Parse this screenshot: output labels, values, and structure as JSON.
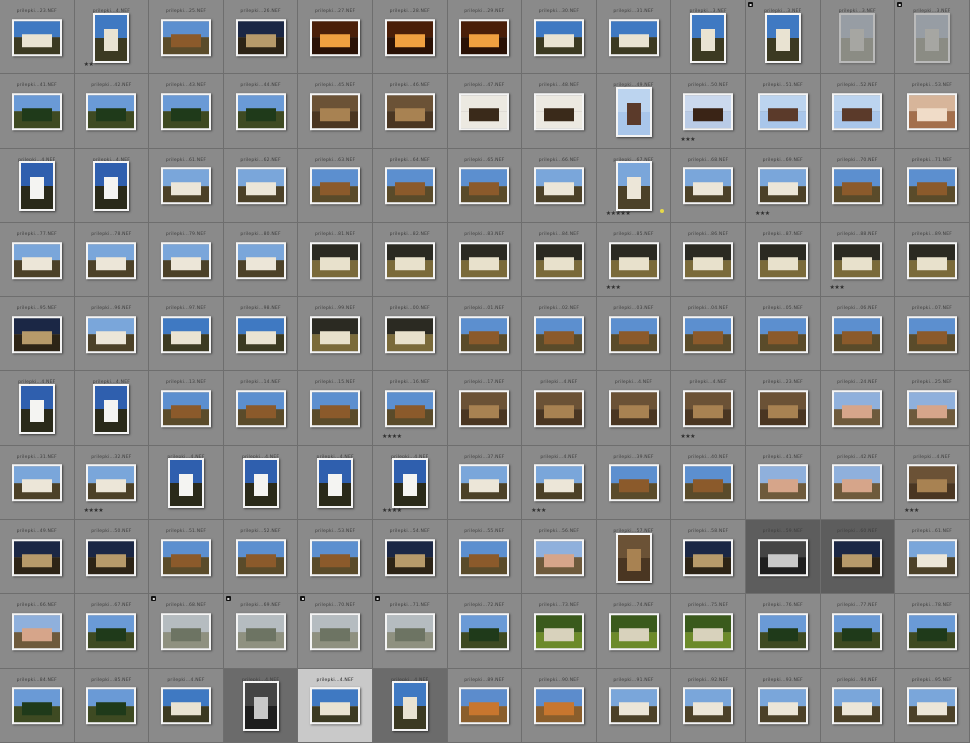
{
  "grid": {
    "columns": 13,
    "rows": 10,
    "cells": [
      {
        "label": "prilepki...23.NEF",
        "o": "land",
        "p": "day-church",
        "stars": 0
      },
      {
        "label": "prilepki...4.NEF",
        "o": "port",
        "p": "day-church",
        "stars": 2
      },
      {
        "label": "prilepki...25.NEF",
        "o": "land",
        "p": "day-house",
        "stars": 0
      },
      {
        "label": "prilepki...26.NEF",
        "o": "land",
        "p": "dusk-house",
        "stars": 0
      },
      {
        "label": "prilepki...27.NEF",
        "o": "land",
        "p": "interior-orange",
        "stars": 0
      },
      {
        "label": "prilepki...28.NEF",
        "o": "land",
        "p": "interior-orange",
        "stars": 0
      },
      {
        "label": "prilepki...29.NEF",
        "o": "land",
        "p": "interior-orange",
        "stars": 0
      },
      {
        "label": "prilepki...30.NEF",
        "o": "land",
        "p": "day-church",
        "stars": 0
      },
      {
        "label": "prilepki...31.NEF",
        "o": "land",
        "p": "day-church",
        "stars": 0
      },
      {
        "label": "prilepki...3.NEF",
        "o": "port",
        "p": "day-church",
        "stars": 0
      },
      {
        "label": "prilepki...3.NEF",
        "o": "port",
        "p": "day-church",
        "stars": 0,
        "badge": true
      },
      {
        "label": "prilepki...3.NEF",
        "o": "port",
        "p": "faded-church",
        "stars": 0,
        "faded": true
      },
      {
        "label": "prilepki...3.NEF",
        "o": "port",
        "p": "faded-church",
        "stars": 0,
        "badge": true,
        "faded": true
      },
      {
        "label": "prilepki...41.NEF",
        "o": "land",
        "p": "day-trees",
        "stars": 0
      },
      {
        "label": "prilepki...42.NEF",
        "o": "land",
        "p": "day-trees",
        "stars": 0
      },
      {
        "label": "prilepki...43.NEF",
        "o": "land",
        "p": "day-trees",
        "stars": 0
      },
      {
        "label": "prilepki...44.NEF",
        "o": "land",
        "p": "day-trees",
        "stars": 0
      },
      {
        "label": "prilepki...45.NEF",
        "o": "land",
        "p": "wood",
        "stars": 0
      },
      {
        "label": "prilepki...46.NEF",
        "o": "land",
        "p": "wood",
        "stars": 0
      },
      {
        "label": "prilepki...47.NEF",
        "o": "land",
        "p": "icons",
        "stars": 0
      },
      {
        "label": "prilepki...48.NEF",
        "o": "land",
        "p": "icons",
        "stars": 0
      },
      {
        "label": "prilepki...49.NEF",
        "o": "port",
        "p": "icons-light",
        "stars": 0
      },
      {
        "label": "prilepki...50.NEF",
        "o": "land",
        "p": "icons-dark",
        "stars": 3
      },
      {
        "label": "prilepki...51.NEF",
        "o": "land",
        "p": "icons-light",
        "stars": 0
      },
      {
        "label": "prilepki...52.NEF",
        "o": "land",
        "p": "icons-light",
        "stars": 0
      },
      {
        "label": "prilepki...53.NEF",
        "o": "land",
        "p": "portrait-warm",
        "stars": 0
      },
      {
        "label": "prilepki...4.NEF",
        "o": "port",
        "p": "white-church",
        "stars": 0
      },
      {
        "label": "prilepki...4.NEF",
        "o": "port",
        "p": "white-church",
        "stars": 0
      },
      {
        "label": "prilepki...61.NEF",
        "o": "land",
        "p": "white-house",
        "stars": 0
      },
      {
        "label": "prilepki...62.NEF",
        "o": "land",
        "p": "white-house",
        "stars": 0
      },
      {
        "label": "prilepki...63.NEF",
        "o": "land",
        "p": "day-house",
        "stars": 0
      },
      {
        "label": "prilepki...64.NEF",
        "o": "land",
        "p": "day-house",
        "stars": 0
      },
      {
        "label": "prilepki...65.NEF",
        "o": "land",
        "p": "day-house",
        "stars": 0
      },
      {
        "label": "prilepki...66.NEF",
        "o": "land",
        "p": "white-house",
        "stars": 0
      },
      {
        "label": "prilepki...67.NEF",
        "o": "port",
        "p": "white-house",
        "stars": 5,
        "flag": true
      },
      {
        "label": "prilepki...68.NEF",
        "o": "land",
        "p": "white-house",
        "stars": 0
      },
      {
        "label": "prilepki...69.NEF",
        "o": "land",
        "p": "white-house",
        "stars": 3
      },
      {
        "label": "prilepki...70.NEF",
        "o": "land",
        "p": "day-house",
        "stars": 0
      },
      {
        "label": "prilepki...71.NEF",
        "o": "land",
        "p": "day-house",
        "stars": 0
      },
      {
        "label": "prilepki...77.NEF",
        "o": "land",
        "p": "white-house",
        "stars": 0
      },
      {
        "label": "prilepki...78.NEF",
        "o": "land",
        "p": "white-house",
        "stars": 0
      },
      {
        "label": "prilepki...79.NEF",
        "o": "land",
        "p": "white-house",
        "stars": 0
      },
      {
        "label": "prilepki...80.NEF",
        "o": "land",
        "p": "white-house",
        "stars": 0
      },
      {
        "label": "prilepki...81.NEF",
        "o": "land",
        "p": "wall",
        "stars": 0
      },
      {
        "label": "prilepki...82.NEF",
        "o": "land",
        "p": "wall",
        "stars": 0
      },
      {
        "label": "prilepki...83.NEF",
        "o": "land",
        "p": "wall",
        "stars": 0
      },
      {
        "label": "prilepki...84.NEF",
        "o": "land",
        "p": "wall",
        "stars": 0
      },
      {
        "label": "prilepki...85.NEF",
        "o": "land",
        "p": "wall",
        "stars": 3
      },
      {
        "label": "prilepki...86.NEF",
        "o": "land",
        "p": "wall",
        "stars": 0
      },
      {
        "label": "prilepki...87.NEF",
        "o": "land",
        "p": "wall",
        "stars": 0
      },
      {
        "label": "prilepki...88.NEF",
        "o": "land",
        "p": "wall",
        "stars": 3
      },
      {
        "label": "prilepki...89.NEF",
        "o": "land",
        "p": "wall",
        "stars": 0
      },
      {
        "label": "prilepki...95.NEF",
        "o": "land",
        "p": "dusk-house",
        "stars": 0
      },
      {
        "label": "prilepki...96.NEF",
        "o": "land",
        "p": "white-house",
        "stars": 0
      },
      {
        "label": "prilepki...97.NEF",
        "o": "land",
        "p": "day-church",
        "stars": 0
      },
      {
        "label": "prilepki...98.NEF",
        "o": "land",
        "p": "day-church",
        "stars": 0
      },
      {
        "label": "prilepki...99.NEF",
        "o": "land",
        "p": "wall",
        "stars": 0
      },
      {
        "label": "prilepki...00.NEF",
        "o": "land",
        "p": "wall",
        "stars": 0
      },
      {
        "label": "prilepki...01.NEF",
        "o": "land",
        "p": "day-house",
        "stars": 0
      },
      {
        "label": "prilepki...02.NEF",
        "o": "land",
        "p": "day-house",
        "stars": 0
      },
      {
        "label": "prilepki...03.NEF",
        "o": "land",
        "p": "day-house",
        "stars": 0
      },
      {
        "label": "prilepki...04.NEF",
        "o": "land",
        "p": "day-house",
        "stars": 0
      },
      {
        "label": "prilepki...05.NEF",
        "o": "land",
        "p": "day-house",
        "stars": 0
      },
      {
        "label": "prilepki...06.NEF",
        "o": "land",
        "p": "day-house",
        "stars": 0
      },
      {
        "label": "prilepki...07.NEF",
        "o": "land",
        "p": "day-house",
        "stars": 0
      },
      {
        "label": "prilepki...4.NEF",
        "o": "port",
        "p": "white-church",
        "stars": 0
      },
      {
        "label": "prilepki...4.NEF",
        "o": "port",
        "p": "white-church",
        "stars": 0
      },
      {
        "label": "prilepki...13.NEF",
        "o": "land",
        "p": "day-house",
        "stars": 0
      },
      {
        "label": "prilepki...14.NEF",
        "o": "land",
        "p": "day-house",
        "stars": 0
      },
      {
        "label": "prilepki...15.NEF",
        "o": "land",
        "p": "day-house",
        "stars": 0
      },
      {
        "label": "prilepki...16.NEF",
        "o": "land",
        "p": "day-house",
        "stars": 4
      },
      {
        "label": "prilepki...17.NEF",
        "o": "land",
        "p": "wood",
        "stars": 0
      },
      {
        "label": "prilepki...4.NEF",
        "o": "land",
        "p": "wood",
        "stars": 0
      },
      {
        "label": "prilepki...4.NEF",
        "o": "land",
        "p": "wood",
        "stars": 0
      },
      {
        "label": "prilepki...4.NEF",
        "o": "land",
        "p": "wood",
        "stars": 3
      },
      {
        "label": "prilepki...23.NEF",
        "o": "land",
        "p": "wood",
        "stars": 0
      },
      {
        "label": "prilepki...24.NEF",
        "o": "land",
        "p": "pink-house",
        "stars": 0
      },
      {
        "label": "prilepki...25.NEF",
        "o": "land",
        "p": "pink-house",
        "stars": 0
      },
      {
        "label": "prilepki...31.NEF",
        "o": "land",
        "p": "white-house",
        "stars": 0
      },
      {
        "label": "prilepki...32.NEF",
        "o": "land",
        "p": "white-house",
        "stars": 4
      },
      {
        "label": "prilepki...4.NEF",
        "o": "port",
        "p": "white-church",
        "stars": 0
      },
      {
        "label": "prilepki...4.NEF",
        "o": "port",
        "p": "white-church",
        "stars": 0
      },
      {
        "label": "prilepki...4.NEF",
        "o": "port",
        "p": "white-church",
        "stars": 0
      },
      {
        "label": "prilepki...4.NEF",
        "o": "port",
        "p": "white-church",
        "stars": 4
      },
      {
        "label": "prilepki...37.NEF",
        "o": "land",
        "p": "white-house",
        "stars": 0
      },
      {
        "label": "prilepki...4.NEF",
        "o": "land",
        "p": "white-house",
        "stars": 3
      },
      {
        "label": "prilepki...39.NEF",
        "o": "land",
        "p": "day-house",
        "stars": 0
      },
      {
        "label": "prilepki...40.NEF",
        "o": "land",
        "p": "day-house",
        "stars": 0
      },
      {
        "label": "prilepki...41.NEF",
        "o": "land",
        "p": "pink-house",
        "stars": 0
      },
      {
        "label": "prilepki...42.NEF",
        "o": "land",
        "p": "pink-house",
        "stars": 0
      },
      {
        "label": "prilepki...4.NEF",
        "o": "land",
        "p": "wood",
        "stars": 3
      },
      {
        "label": "prilepki...49.NEF",
        "o": "land",
        "p": "dusk-house",
        "stars": 0
      },
      {
        "label": "prilepki...50.NEF",
        "o": "land",
        "p": "dusk-house",
        "stars": 0
      },
      {
        "label": "prilepki...51.NEF",
        "o": "land",
        "p": "day-house",
        "stars": 0
      },
      {
        "label": "prilepki...52.NEF",
        "o": "land",
        "p": "day-house",
        "stars": 0
      },
      {
        "label": "prilepki...53.NEF",
        "o": "land",
        "p": "day-house",
        "stars": 0
      },
      {
        "label": "prilepki...54.NEF",
        "o": "land",
        "p": "dusk-house",
        "stars": 0
      },
      {
        "label": "prilepki...55.NEF",
        "o": "land",
        "p": "day-house",
        "stars": 0
      },
      {
        "label": "prilepki...56.NEF",
        "o": "land",
        "p": "pink-house",
        "stars": 0
      },
      {
        "label": "prilepki...57.NEF",
        "o": "port",
        "p": "wood",
        "stars": 0
      },
      {
        "label": "prilepki...58.NEF",
        "o": "land",
        "p": "dusk-house",
        "stars": 0
      },
      {
        "label": "prilepki...59.NEF",
        "o": "land",
        "p": "mono",
        "stars": 0,
        "sel": "sel-dark"
      },
      {
        "label": "prilepki...60.NEF",
        "o": "land",
        "p": "dusk-house",
        "stars": 0,
        "sel": "sel-dark"
      },
      {
        "label": "prilepki...61.NEF",
        "o": "land",
        "p": "white-house",
        "stars": 0
      },
      {
        "label": "prilepki...66.NEF",
        "o": "land",
        "p": "pink-house",
        "stars": 0
      },
      {
        "label": "prilepki...67.NEF",
        "o": "land",
        "p": "day-trees",
        "stars": 0
      },
      {
        "label": "prilepki...68.NEF",
        "o": "land",
        "p": "faded-trees",
        "stars": 0,
        "badge": true
      },
      {
        "label": "prilepki...69.NEF",
        "o": "land",
        "p": "faded-trees",
        "stars": 0,
        "badge": true
      },
      {
        "label": "prilepki...70.NEF",
        "o": "land",
        "p": "faded-trees",
        "stars": 0,
        "badge": true
      },
      {
        "label": "prilepki...71.NEF",
        "o": "land",
        "p": "faded-trees",
        "stars": 0,
        "badge": true
      },
      {
        "label": "prilepki...72.NEF",
        "o": "land",
        "p": "day-trees",
        "stars": 0
      },
      {
        "label": "prilepki...73.NEF",
        "o": "land",
        "p": "field",
        "stars": 0
      },
      {
        "label": "prilepki...74.NEF",
        "o": "land",
        "p": "field",
        "stars": 0
      },
      {
        "label": "prilepki...75.NEF",
        "o": "land",
        "p": "field",
        "stars": 0
      },
      {
        "label": "prilepki...76.NEF",
        "o": "land",
        "p": "day-trees",
        "stars": 0
      },
      {
        "label": "prilepki...77.NEF",
        "o": "land",
        "p": "day-trees",
        "stars": 0
      },
      {
        "label": "prilepki...78.NEF",
        "o": "land",
        "p": "day-trees",
        "stars": 0
      },
      {
        "label": "prilepki...84.NEF",
        "o": "land",
        "p": "day-trees",
        "stars": 0
      },
      {
        "label": "prilepki...85.NEF",
        "o": "land",
        "p": "day-trees",
        "stars": 0
      },
      {
        "label": "prilepki...4.NEF",
        "o": "land",
        "p": "day-church",
        "stars": 0
      },
      {
        "label": "prilepki...4.NEF",
        "o": "port",
        "p": "mono",
        "stars": 0,
        "sel": "sel-mid"
      },
      {
        "label": "prilepki...4.NEF",
        "o": "land",
        "p": "day-church",
        "stars": 0,
        "sel": "sel-light"
      },
      {
        "label": "prilepki...4.NEF",
        "o": "port",
        "p": "day-church",
        "stars": 0,
        "sel": "sel-mid"
      },
      {
        "label": "prilepki...89.NEF",
        "o": "land",
        "p": "autumn",
        "stars": 0
      },
      {
        "label": "prilepki...90.NEF",
        "o": "land",
        "p": "autumn",
        "stars": 0
      },
      {
        "label": "prilepki...91.NEF",
        "o": "land",
        "p": "white-house",
        "stars": 0
      },
      {
        "label": "prilepki...92.NEF",
        "o": "land",
        "p": "white-house",
        "stars": 0
      },
      {
        "label": "prilepki...93.NEF",
        "o": "land",
        "p": "white-house",
        "stars": 0
      },
      {
        "label": "prilepki...94.NEF",
        "o": "land",
        "p": "white-house",
        "stars": 0
      },
      {
        "label": "prilepki...95.NEF",
        "o": "land",
        "p": "white-house",
        "stars": 0
      }
    ]
  },
  "palettes": {
    "day-church": {
      "sky": "#3f79c2",
      "ground": "#3c3a22",
      "bldg": "#e9e3d2"
    },
    "day-house": {
      "sky": "#5c8fcf",
      "ground": "#5a4b2a",
      "bldg": "#8b5a2b"
    },
    "dusk-house": {
      "sky": "#1b2745",
      "ground": "#2d2416",
      "bldg": "#b79a6a"
    },
    "interior-orange": {
      "sky": "#4a1e08",
      "ground": "#2a1105",
      "bldg": "#f0a040"
    },
    "day-trees": {
      "sky": "#6a9ad6",
      "ground": "#3e4a22",
      "bldg": "#1f3a1a"
    },
    "wood": {
      "sky": "#6b5236",
      "ground": "#4a3622",
      "bldg": "#a88252"
    },
    "icons": {
      "sky": "#ece9e1",
      "ground": "#ece9e1",
      "bldg": "#3a2a1a"
    },
    "icons-light": {
      "sky": "#bcd4ef",
      "ground": "#a9c6ea",
      "bldg": "#5b3a2a"
    },
    "icons-dark": {
      "sky": "#cbd9ee",
      "ground": "#b9cbe6",
      "bldg": "#3a2416"
    },
    "portrait-warm": {
      "sky": "#d7b59a",
      "ground": "#a36f4c",
      "bldg": "#f0dcc8"
    },
    "white-church": {
      "sky": "#2f5fae",
      "ground": "#2a2a1a",
      "bldg": "#f4f4f2"
    },
    "white-house": {
      "sky": "#7aa6da",
      "ground": "#4c4128",
      "bldg": "#ece6d8"
    },
    "wall": {
      "sky": "#2b2a22",
      "ground": "#7a6a3a",
      "bldg": "#e8e1cc"
    },
    "pink-house": {
      "sky": "#8fb0dc",
      "ground": "#6e5a3c",
      "bldg": "#d6a58a"
    },
    "faded-church": {
      "sky": "#a7b4c4",
      "ground": "#8e8f7e",
      "bldg": "#c9c8c0"
    },
    "faded-trees": {
      "sky": "#b5bcc0",
      "ground": "#8f9180",
      "bldg": "#6d7463"
    },
    "mono": {
      "sky": "#444444",
      "ground": "#1e1e1e",
      "bldg": "#c8c8c8"
    },
    "field": {
      "sky": "#3a5a1c",
      "ground": "#6c8a2a",
      "bldg": "#d8d2bc"
    },
    "autumn": {
      "sky": "#5c8ccc",
      "ground": "#8a5e2c",
      "bldg": "#c8762e"
    }
  },
  "ui": {
    "star_char": "★",
    "badge_char": "▪"
  }
}
